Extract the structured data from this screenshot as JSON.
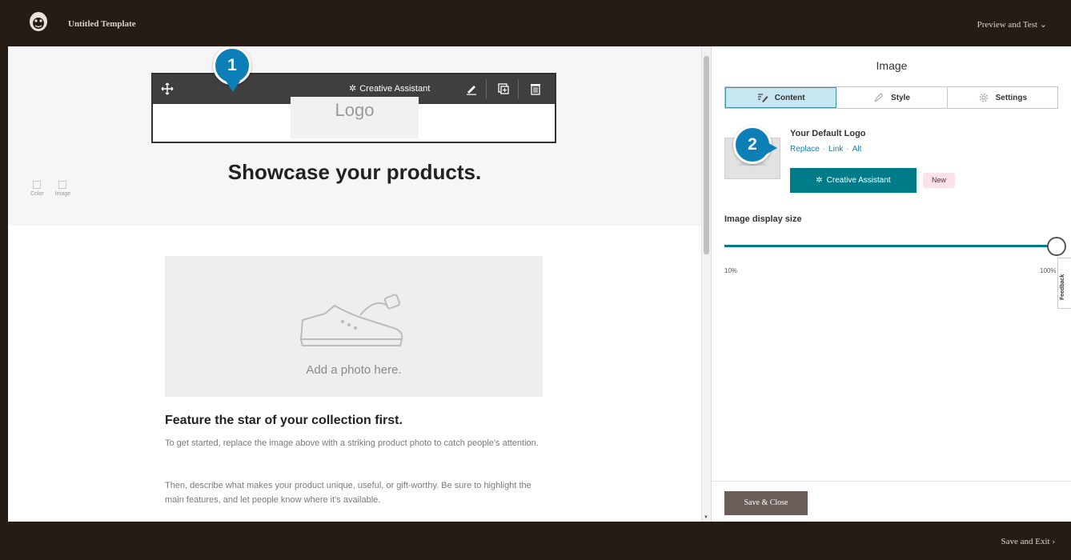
{
  "header": {
    "template_title": "Untitled Template",
    "preview_label": "Preview and Test ⌄",
    "logo_icon": "freddie-logo-icon"
  },
  "footer": {
    "save_exit_label": "Save and Exit ›"
  },
  "canvas": {
    "bg_tools": [
      {
        "label": "Color",
        "icon": "color-icon"
      },
      {
        "label": "Image",
        "icon": "image-icon"
      }
    ],
    "logo_toolbar": {
      "move_icon": "move-icon",
      "creative_assistant_label": "Creative Assistant",
      "edit_icon": "pencil-icon",
      "duplicate_icon": "duplicate-icon",
      "delete_icon": "trash-icon"
    },
    "logo_placeholder": "Logo",
    "headline": "Showcase your products.",
    "photo_placeholder": "Add a photo here.",
    "feature_title": "Feature the star of your collection first.",
    "paragraph_1": "To get started, replace the image above with a striking product photo to catch people's attention.",
    "paragraph_2": "Then, describe what makes your product unique, useful, or gift-worthy. Be sure to highlight the main features, and let people know where it's available."
  },
  "callouts": {
    "one": "1",
    "two": "2"
  },
  "panel": {
    "title": "Image",
    "tabs": [
      {
        "label": "Content",
        "icon": "edit-content-icon",
        "active": true
      },
      {
        "label": "Style",
        "icon": "style-icon",
        "active": false
      },
      {
        "label": "Settings",
        "icon": "gear-icon",
        "active": false
      }
    ],
    "image_name": "Your Default Logo",
    "links": [
      "Replace",
      "Link",
      "Alt"
    ],
    "creative_assistant_label": "Creative Assistant",
    "new_badge": "New",
    "size_label": "Image display size",
    "size_min": "10%",
    "size_max": "100%",
    "size_value_percent": 100,
    "feedback_label": "Feedback",
    "save_close_label": "Save & Close"
  },
  "colors": {
    "chrome": "#241c15",
    "accent_teal": "#007c89",
    "callout_blue": "#0b7fb6",
    "active_tab": "#c7e6ef",
    "new_badge_bg": "#fbe1ea",
    "save_close_bg": "#6a5d57"
  }
}
